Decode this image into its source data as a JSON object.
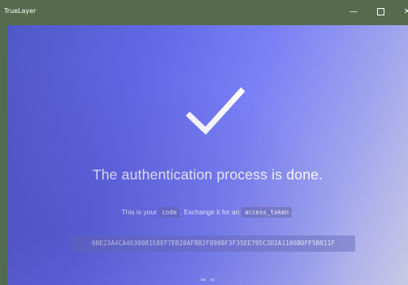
{
  "window": {
    "title": "TrueLayer",
    "controls": {
      "minimize_icon": "minimize-icon",
      "maximize_icon": "maximize-icon",
      "close_icon": "close-icon",
      "minimize_glyph": "—",
      "close_glyph": "✕"
    }
  },
  "page": {
    "check_icon": "checkmark-icon",
    "headline": "The authentication process is done.",
    "subline_prefix": "This is your",
    "code_word": "code",
    "subline_middle": ". Exchange it for an",
    "access_token_word": "access_token",
    "subline_suffix": ".",
    "code_value": "6BE23A4CA4630081E8EF7EB20AFBB2F890BF3F35EE795C3D2A1186BDFF5B011F"
  },
  "colors": {
    "titlebar": "#566b4e",
    "gradient_start": "#5057c5",
    "gradient_mid": "#7a80f5",
    "gradient_end": "#c9c8e6",
    "text": "#ffffff"
  }
}
